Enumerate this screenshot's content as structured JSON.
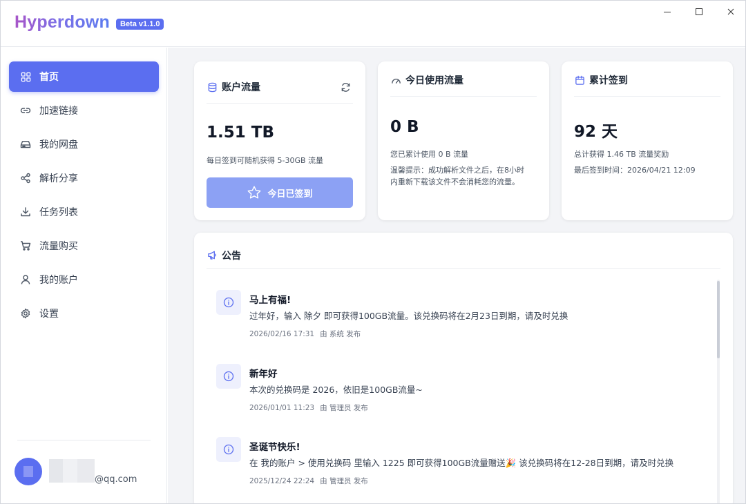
{
  "app": {
    "name": "Hyperdown",
    "version_badge": "Beta v1.1.0"
  },
  "window_controls": [
    "minimize-icon",
    "maximize-icon",
    "close-icon"
  ],
  "sidebar": {
    "items": [
      {
        "label": "首页",
        "icon": "grid-icon",
        "active": true
      },
      {
        "label": "加速链接",
        "icon": "link-icon",
        "active": false
      },
      {
        "label": "我的网盘",
        "icon": "drive-icon",
        "active": false
      },
      {
        "label": "解析分享",
        "icon": "share-icon",
        "active": false
      },
      {
        "label": "任务列表",
        "icon": "download-icon",
        "active": false
      },
      {
        "label": "流量购买",
        "icon": "cart-icon",
        "active": false
      },
      {
        "label": "我的账户",
        "icon": "user-icon",
        "active": false
      },
      {
        "label": "设置",
        "icon": "gear-icon",
        "active": false
      }
    ],
    "user": {
      "email_suffix": "@qq.com"
    }
  },
  "cards": {
    "traffic": {
      "title": "账户流量",
      "value": "1.51 TB",
      "desc": "每日签到可随机获得 5-30GB 流量",
      "button": "今日已签到"
    },
    "today": {
      "title": "今日使用流量",
      "value": "0 B",
      "desc": "您已累计使用 0 B 流量",
      "tip_line1": "温馨提示：成功解析文件之后，在8小时",
      "tip_line2": "内重新下载该文件不会消耗您的流量。"
    },
    "checkin": {
      "title": "累计签到",
      "value": "92 天",
      "desc": "总计获得 1.46 TB 流量奖励",
      "last": "最后签到时间：2026/04/21 12:09"
    }
  },
  "announcements": {
    "title": "公告",
    "items": [
      {
        "title": "马上有福!",
        "body": "过年好，输入 除夕 即可获得100GB流量。该兑换码将在2月23日到期，请及时兑换",
        "time": "2026/02/16 17:31",
        "by": "由 系统 发布"
      },
      {
        "title": "新年好",
        "body": "本次的兑换码是 2026，依旧是100GB流量~",
        "time": "2026/01/01 11:23",
        "by": "由 管理员 发布"
      },
      {
        "title": "圣诞节快乐!",
        "body": "在 我的账户 > 使用兑换码 里输入 1225 即可获得100GB流量赠送🎉 该兑换码将在12-28日到期，请及时兑换",
        "time": "2025/12/24 22:24",
        "by": "由 管理员 发布"
      }
    ]
  },
  "colors": {
    "accent": "#5b6ef0",
    "button_disabled": "#8ca1f4",
    "main_bg": "#f3f4f7"
  }
}
